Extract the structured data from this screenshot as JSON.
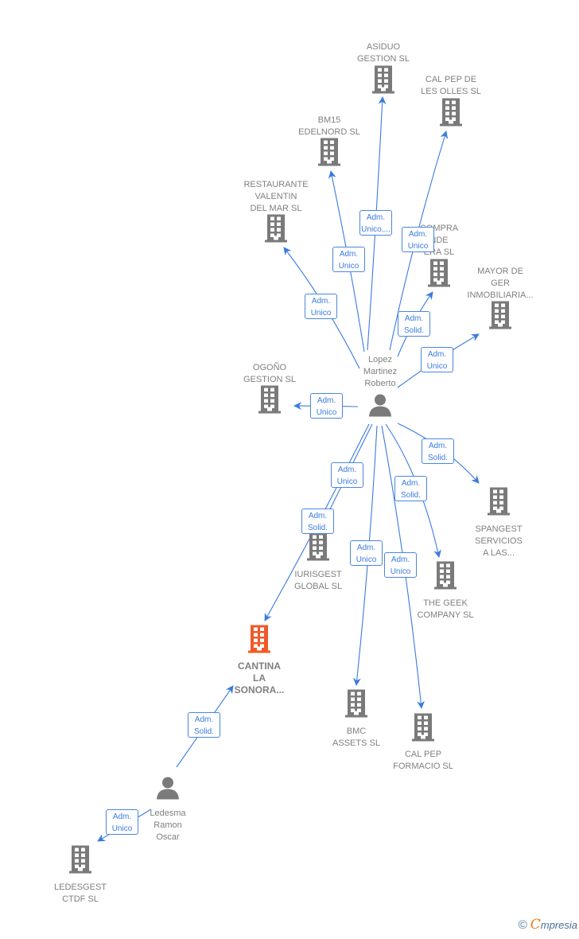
{
  "colors": {
    "edge": "#3a7be0",
    "company": "#7a7a7a",
    "highlight": "#f05a28",
    "person": "#7a7a7a"
  },
  "nodes": [
    {
      "id": "asiduo",
      "type": "company",
      "label": "ASIDUO\nGESTION  SL"
    },
    {
      "id": "calpep_olles",
      "type": "company",
      "label": "CAL PEP DE\nLES OLLES  SL"
    },
    {
      "id": "bm15",
      "type": "company",
      "label": "BM15\nEDELNORD  SL"
    },
    {
      "id": "restaurante",
      "type": "company",
      "label": "RESTAURANTE\nVALENTIN\nDEL MAR  SL"
    },
    {
      "id": "compra",
      "type": "company",
      "label": "COMPRA\nNDE\nERA  SL"
    },
    {
      "id": "mayor",
      "type": "company",
      "label": "MAYOR DE\nGER\nINMOBILIARIA..."
    },
    {
      "id": "ogono",
      "type": "company",
      "label": "OGOÑO\nGESTION SL"
    },
    {
      "id": "lopez",
      "type": "person",
      "label": "Lopez\nMartinez\nRoberto"
    },
    {
      "id": "spangest",
      "type": "company",
      "label": "SPANGEST\nSERVICIOS\nA LAS..."
    },
    {
      "id": "iurisgest",
      "type": "company",
      "label": "IURISGEST\nGLOBAL  SL"
    },
    {
      "id": "geek",
      "type": "company",
      "label": "THE GEEK\nCOMPANY  SL"
    },
    {
      "id": "cantina",
      "type": "company-main",
      "label": "CANTINA\nLA\nSONORA..."
    },
    {
      "id": "bmc",
      "type": "company",
      "label": "BMC\nASSETS SL"
    },
    {
      "id": "calpep_form",
      "type": "company",
      "label": "CAL PEP\nFORMACIO  SL"
    },
    {
      "id": "ledesma",
      "type": "person",
      "label": "Ledesma\nRamon\nOscar"
    },
    {
      "id": "ledesgest",
      "type": "company",
      "label": "LEDESGEST\nCTDF  SL"
    }
  ],
  "edges": [
    {
      "from": "lopez",
      "to": "asiduo",
      "role": "Adm.\nUnico,..."
    },
    {
      "from": "lopez",
      "to": "calpep_olles",
      "role": "Adm.\nUnico"
    },
    {
      "from": "lopez",
      "to": "bm15",
      "role": "Adm.\nUnico"
    },
    {
      "from": "lopez",
      "to": "restaurante",
      "role": "Adm.\nUnico"
    },
    {
      "from": "lopez",
      "to": "compra",
      "role": "Adm.\nSolid."
    },
    {
      "from": "lopez",
      "to": "mayor",
      "role": "Adm.\nUnico"
    },
    {
      "from": "lopez",
      "to": "ogono",
      "role": "Adm.\nUnico"
    },
    {
      "from": "lopez",
      "to": "spangest",
      "role": "Adm.\nSolid."
    },
    {
      "from": "lopez",
      "to": "geek",
      "role": "Adm.\nSolid."
    },
    {
      "from": "lopez",
      "to": "iurisgest",
      "role": "Adm.\nUnico"
    },
    {
      "from": "lopez",
      "to": "cantina",
      "role": "Adm.\nSolid."
    },
    {
      "from": "lopez",
      "to": "bmc",
      "role": "Adm.\nUnico"
    },
    {
      "from": "lopez",
      "to": "calpep_form",
      "role": "Adm.\nUnico"
    },
    {
      "from": "ledesma",
      "to": "cantina",
      "role": "Adm.\nSolid."
    },
    {
      "from": "ledesma",
      "to": "ledesgest",
      "role": "Adm.\nUnico"
    }
  ],
  "footer": {
    "copyright": "©",
    "brand_e": "C",
    "brand_rest": "mpresia"
  }
}
